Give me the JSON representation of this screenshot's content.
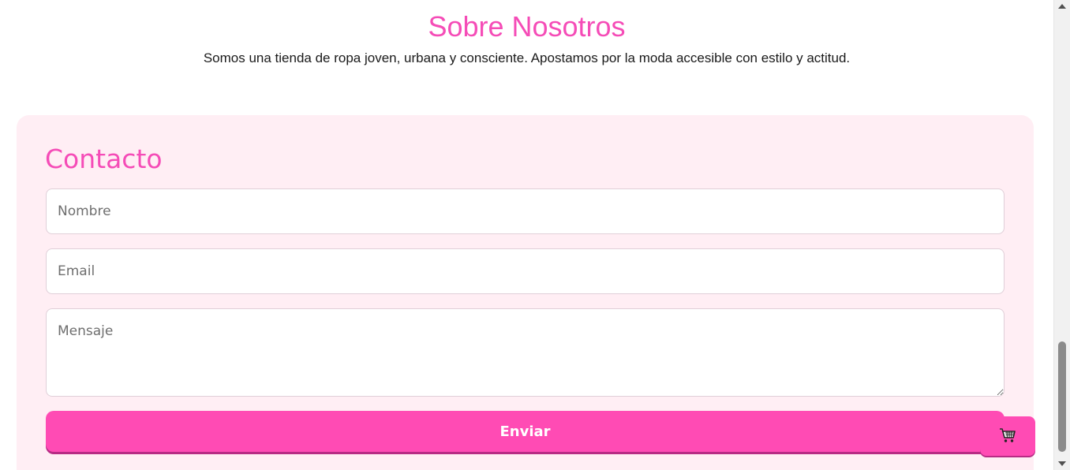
{
  "about": {
    "title": "Sobre Nosotros",
    "text": "Somos una tienda de ropa joven, urbana y consciente. Apostamos por la moda accesible con estilo y actitud."
  },
  "contact": {
    "title": "Contacto",
    "name_placeholder": "Nombre",
    "email_placeholder": "Email",
    "message_placeholder": "Mensaje",
    "submit_label": "Enviar"
  },
  "cart": {
    "icon": "shopping-cart-icon"
  },
  "colors": {
    "accent": "#f54cb7",
    "button": "#ff4bb4",
    "section_bg": "#ffeef4"
  }
}
